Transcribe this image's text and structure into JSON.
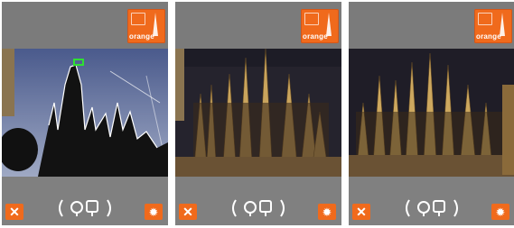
{
  "screens": [
    {
      "brand": {
        "label": "orange",
        "ar_mark": "AR"
      },
      "controls": {
        "close_icon": "close-icon",
        "settings_icon": "gear-icon",
        "mode_icon": "camera-phone-icon"
      }
    },
    {
      "brand": {
        "label": "orange",
        "ar_mark": "AR"
      },
      "controls": {
        "close_icon": "close-icon",
        "settings_icon": "gear-icon",
        "mode_icon": "camera-phone-icon"
      }
    },
    {
      "brand": {
        "label": "orange",
        "ar_mark": "AR"
      },
      "controls": {
        "close_icon": "close-icon",
        "settings_icon": "gear-icon",
        "mode_icon": "camera-phone-icon"
      }
    }
  ],
  "colors": {
    "accent": "#f06a1c",
    "chrome": "#7b7b7b"
  }
}
